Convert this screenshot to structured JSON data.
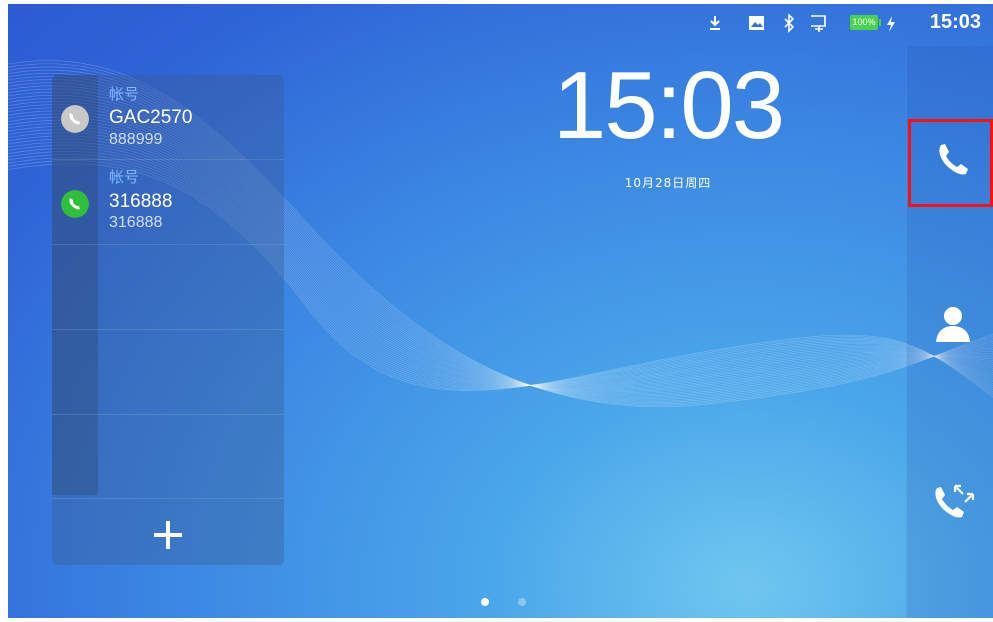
{
  "status_bar": {
    "time": "15:03",
    "battery_level": "100%",
    "icons": [
      "download-icon",
      "image-icon",
      "bluetooth-icon",
      "ethernet-icon",
      "battery-icon",
      "charging-icon"
    ]
  },
  "clock": {
    "time": "15:03",
    "date": "10月28日周四"
  },
  "accounts": [
    {
      "label": "帐号",
      "name": "GAC2570",
      "number": "888999",
      "status_color": "#c8c8c8",
      "icon": "phone-icon"
    },
    {
      "label": "帐号",
      "name": "316888",
      "number": "316888",
      "status_color": "#2fbf3a",
      "icon": "phone-icon"
    }
  ],
  "add_account": {
    "icon": "plus-icon"
  },
  "dock": {
    "items": [
      {
        "name": "dialer",
        "icon": "phone-icon",
        "highlighted": true
      },
      {
        "name": "contacts",
        "icon": "contact-icon",
        "highlighted": false
      },
      {
        "name": "call-history",
        "icon": "call-log-icon",
        "highlighted": false
      }
    ],
    "highlight_color": "#ff1010"
  },
  "page_indicator": {
    "pages": 2,
    "current": 1
  }
}
